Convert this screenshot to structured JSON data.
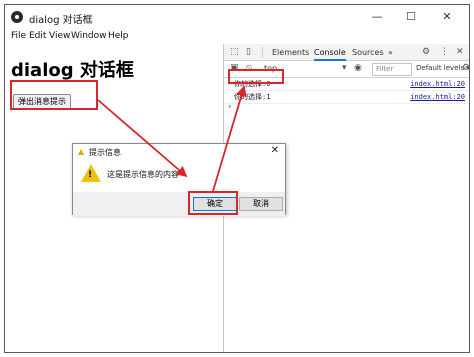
{
  "window": {
    "title": "dialog 对话框",
    "minimize_icon": "—",
    "maximize_icon": "☐",
    "close_icon": "✕"
  },
  "menu": [
    "File",
    "Edit",
    "View",
    "Window",
    "Help"
  ],
  "page": {
    "heading": "dialog 对话框",
    "button_label": "弹出消息提示"
  },
  "devtools": {
    "tabs": [
      "Elements",
      "Console",
      "Sources"
    ],
    "active_tab": "Console",
    "more_tabs": "»",
    "context": "top",
    "filter_placeholder": "Filter",
    "levels": "Default levels ▾",
    "logs": [
      {
        "message": "你的选择:0",
        "source": "index.html:20"
      },
      {
        "message": "你的选择:1",
        "source": "index.html:20"
      }
    ],
    "prompt": "›"
  },
  "dialog": {
    "title": "提示信息",
    "message": "这是提示信息的内容",
    "ok_label": "确定",
    "cancel_label": "取消",
    "close_icon": "✕"
  },
  "colors": {
    "annotation": "#d9252c",
    "accent": "#1a73e8",
    "warning": "#f2c200"
  }
}
